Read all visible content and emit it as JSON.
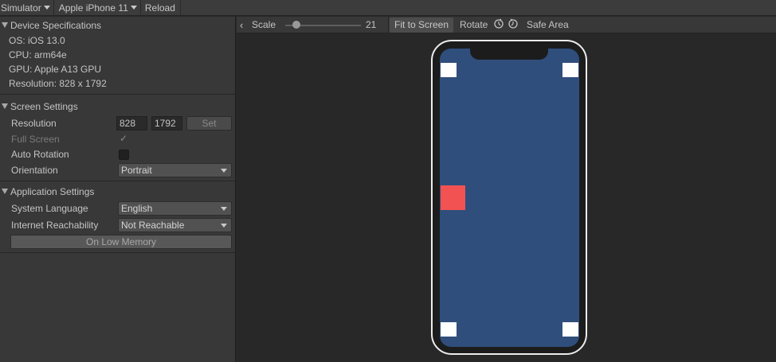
{
  "toolbar": {
    "simulator_label": "Simulator",
    "device_label": "Apple iPhone 11",
    "reload_label": "Reload"
  },
  "device_specs": {
    "title": "Device Specifications",
    "os": "OS: iOS 13.0",
    "cpu": "CPU: arm64e",
    "gpu": "GPU: Apple A13 GPU",
    "resolution": "Resolution: 828 x 1792"
  },
  "screen_settings": {
    "title": "Screen Settings",
    "resolution_label": "Resolution",
    "width_value": "828",
    "height_value": "1792",
    "set_label": "Set",
    "full_screen_label": "Full Screen",
    "full_screen_checked": true,
    "auto_rotation_label": "Auto Rotation",
    "auto_rotation_checked": false,
    "orientation_label": "Orientation",
    "orientation_value": "Portrait"
  },
  "app_settings": {
    "title": "Application Settings",
    "language_label": "System Language",
    "language_value": "English",
    "reachability_label": "Internet Reachability",
    "reachability_value": "Not Reachable",
    "low_memory_label": "On Low Memory"
  },
  "view_toolbar": {
    "scale_label": "Scale",
    "scale_value": "21",
    "fit_label": "Fit to Screen",
    "rotate_label": "Rotate",
    "safe_area_label": "Safe Area"
  },
  "colors": {
    "screen_background": "#2f4e7c",
    "device_frame": "#ececec",
    "red_marker": "#f35252",
    "corner_marker": "#ffffff"
  }
}
